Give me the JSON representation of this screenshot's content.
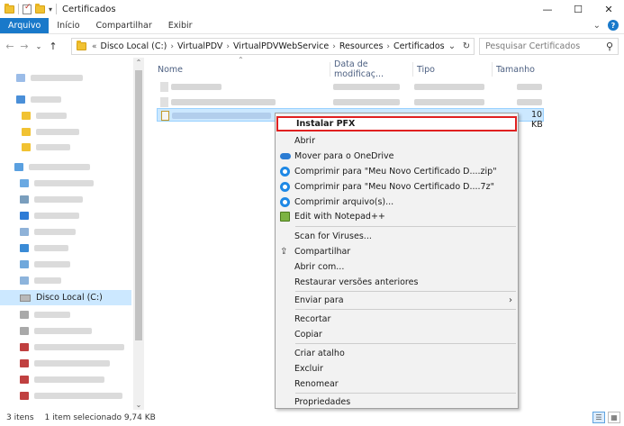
{
  "window": {
    "title": "Certificados",
    "buttons": {
      "minimize": "—",
      "maximize": "☐",
      "close": "✕"
    }
  },
  "ribbon": {
    "tabs": [
      "Arquivo",
      "Início",
      "Compartilhar",
      "Exibir"
    ],
    "active_tab": "Arquivo",
    "expand": "⌄",
    "help": "?"
  },
  "nav": {
    "back": "←",
    "forward": "→",
    "recent": "⌄",
    "up": "↑",
    "address_prefix": "«",
    "breadcrumbs": [
      "Disco Local (C:)",
      "VirtualPDV",
      "VirtualPDVWebService",
      "Resources",
      "Certificados"
    ],
    "crumb_sep": "›",
    "address_dropdown": "⌄",
    "refresh": "↻",
    "search_placeholder": "Pesquisar Certificados",
    "search_icon": "⚲"
  },
  "navpane": {
    "selected_label": "Disco Local (C:)",
    "scroll_up": "⌃",
    "scroll_down": "⌄"
  },
  "columns": {
    "name": "Nome",
    "date": "Data de modificaç...",
    "type": "Tipo",
    "size": "Tamanho",
    "sort_caret": "⌃"
  },
  "files": {
    "selected_size": "10 KB"
  },
  "statusbar": {
    "items_count": "3 itens",
    "selection": "1 item selecionado  9,74 KB",
    "view_details": "☰",
    "view_tiles": "▦"
  },
  "context_menu": {
    "items": [
      {
        "label": "Instalar PFX",
        "icon": "none"
      },
      {
        "label": "Abrir",
        "icon": "none"
      },
      {
        "label": "Mover para o OneDrive",
        "icon": "onedrive-cloud-icon"
      },
      {
        "label": "Comprimir para \"Meu Novo Certificado D....zip\"",
        "icon": "compress-icon"
      },
      {
        "label": "Comprimir para \"Meu Novo Certificado D....7z\"",
        "icon": "compress-icon"
      },
      {
        "label": "Comprimir arquivo(s)...",
        "icon": "compress-icon"
      },
      {
        "label": "Edit with Notepad++",
        "icon": "notepadpp-icon"
      },
      {
        "label": "Scan for Viruses...",
        "icon": "none"
      },
      {
        "label": "Compartilhar",
        "icon": "share-icon"
      },
      {
        "label": "Abrir com...",
        "icon": "none"
      },
      {
        "label": "Restaurar versões anteriores",
        "icon": "none"
      },
      {
        "label": "Enviar para",
        "icon": "none",
        "submenu_arrow": "›"
      },
      {
        "label": "Recortar",
        "icon": "none"
      },
      {
        "label": "Copiar",
        "icon": "none"
      },
      {
        "label": "Criar atalho",
        "icon": "none"
      },
      {
        "label": "Excluir",
        "icon": "none"
      },
      {
        "label": "Renomear",
        "icon": "none"
      },
      {
        "label": "Propriedades",
        "icon": "none"
      }
    ],
    "highlight_color": "#e02020"
  },
  "colors": {
    "accent": "#1979ca",
    "selection": "#cce8ff"
  }
}
